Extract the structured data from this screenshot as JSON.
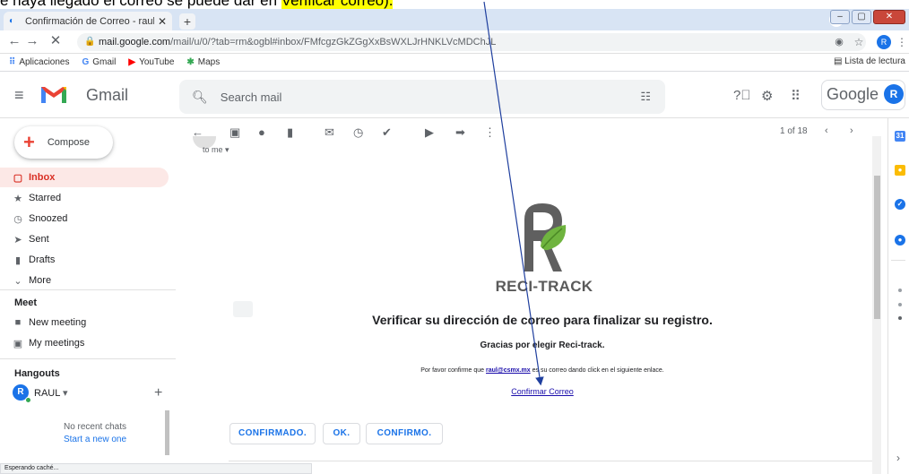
{
  "caption": {
    "prefix": "e haya llegado el correo  se puede dar en ",
    "highlight": "Verificar  correo).",
    "suffix": ""
  },
  "browser": {
    "tab_title": "Confirmación de Correo - raul@c",
    "url_host": "mail.google.com",
    "url_path": "/mail/u/0/?tab=rm&ogbl#inbox/FMfcgzGkZGgXxBsWXLJrHNKLVcMDChJL",
    "profile_initial": "R",
    "bookmarks": [
      {
        "label": "Aplicaciones",
        "icon": "apps-grid-icon"
      },
      {
        "label": "Gmail",
        "icon": "google-g-icon"
      },
      {
        "label": "YouTube",
        "icon": "youtube-icon"
      },
      {
        "label": "Maps",
        "icon": "maps-icon"
      }
    ],
    "reading_list": "Lista de lectura"
  },
  "gmail": {
    "app_name": "Gmail",
    "search_placeholder": "Search mail",
    "google_word": "Google",
    "avatar_initial": "R",
    "compose_label": "Compose",
    "nav": [
      {
        "label": "Inbox",
        "icon": "inbox-icon",
        "active": true
      },
      {
        "label": "Starred",
        "icon": "star-icon"
      },
      {
        "label": "Snoozed",
        "icon": "clock-icon"
      },
      {
        "label": "Sent",
        "icon": "send-icon"
      },
      {
        "label": "Drafts",
        "icon": "draft-icon"
      },
      {
        "label": "More",
        "icon": "chevron-down-icon"
      }
    ],
    "meet_title": "Meet",
    "meet_items": [
      {
        "label": "New meeting",
        "icon": "video-icon"
      },
      {
        "label": "My meetings",
        "icon": "calendar-icon"
      }
    ],
    "hangouts_title": "Hangouts",
    "hangouts_user": "RAUL",
    "no_chats": "No recent chats",
    "start_new": "Start a new one",
    "pager": "1 of 18",
    "to_me": "to me"
  },
  "email": {
    "brand": "RECI-TRACK",
    "headline": "Verificar su dirección de correo para finalizar su registro.",
    "thanks": "Gracias por elegir Reci-track.",
    "please_prefix": "Por favor confirme que ",
    "email_address": "raul@csmx.mx",
    "please_suffix": " es su correo dando click en el siguiente enlace.",
    "confirm_link": "Confirmar Correo",
    "smart_replies": [
      "CONFIRMADO.",
      "OK.",
      "CONFIRMO."
    ]
  },
  "status_text": "Esperando caché...",
  "colors": {
    "accent": "#1a73e8",
    "active_bg": "#fce8e6",
    "active_fg": "#d93025",
    "leaf_green": "#6fb43f",
    "arrow": "#1f3f9e"
  }
}
